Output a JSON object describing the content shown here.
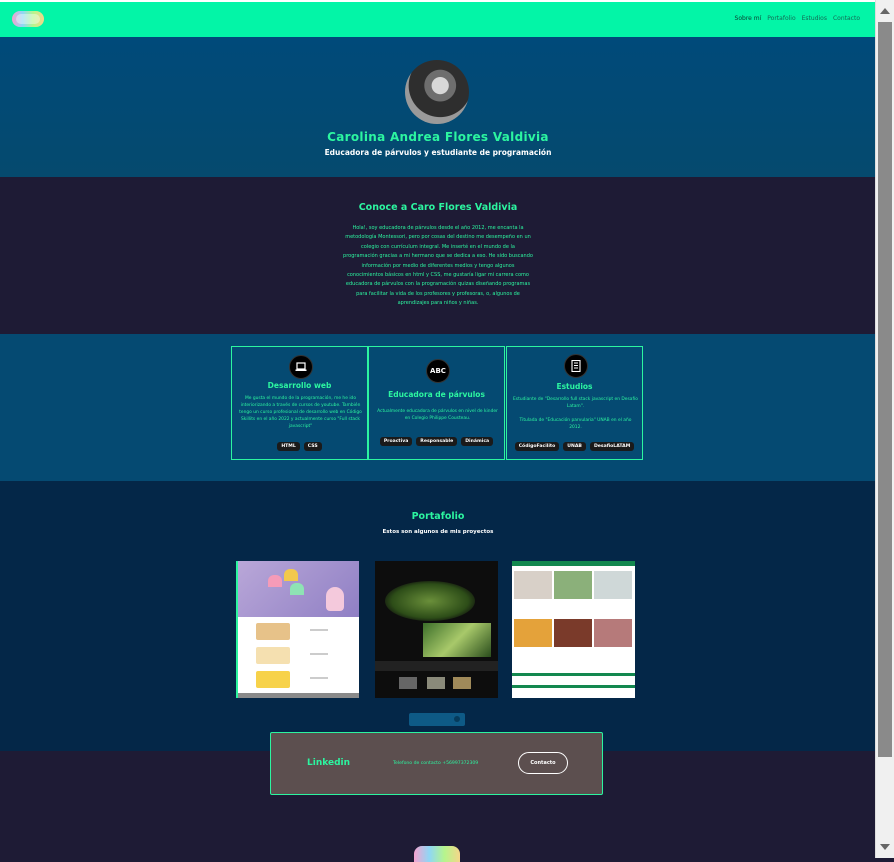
{
  "navbar": {
    "links": [
      "Sobre mí",
      "Portafolio",
      "Estudios",
      "Contacto"
    ]
  },
  "hero": {
    "name": "Carolina Andrea Flores Valdivia",
    "subtitle": "Educadora de párvulos y estudiante de programación"
  },
  "about": {
    "title": "Conoce a Caro Flores Valdivia",
    "text": "Hola!, soy educadora de párvulos desde el año 2012, me encanta la metodología Montessori, pero por cosas del destino me desempeño en un colegio con currículum integral. Me inserté en el mundo de la programación gracias a mi hermano que se dedica a eso. He sido buscando información por medio de diferentes medios y tengo algunos conocimientos básicos en html y CSS, me gustaría ligar mi carrera como educadora de párvulos con la programación quizas diseñando programas para facilitar la vida de los profesores y profesoras, o, algunos de aprendizajes para niños y niñas."
  },
  "skills": [
    {
      "icon": "laptop-icon",
      "title": "Desarrollo web",
      "text": "Me gusta el mundo de la programación, me he ido interiorizando a través de cursos de youtube. También tengo un curso profesional de desarrollo web en Código Skillits en el año 2022 y actualmente curso \"Full stack javascript\"",
      "badges": [
        "HTML",
        "CSS"
      ]
    },
    {
      "icon": "abc-icon",
      "icon_text": "ABC",
      "title": "Educadora de párvulos",
      "text": "Actualmente educadora de párvulos en nivel de kinder en Colegio Philippe Cousteau.",
      "badges": [
        "Proactiva",
        "Responsable",
        "Dinámica"
      ]
    },
    {
      "icon": "notebook-icon",
      "title": "Estudios",
      "text": "Estudiante de \"Desarrollo full stack javascript en Desafío Latam\".",
      "text2": "Titulada de \"Educación parvularia\" UNAB en el año 2012.",
      "badges": [
        "CódigoFacilito",
        "UNAB",
        "DesafioLATAM"
      ]
    }
  ],
  "portfolio": {
    "title": "Portafolio",
    "subtitle": "Estos son algunos de mis proyectos"
  },
  "contact": {
    "linkedin": "Linkedin",
    "phone": "Telefono de contacto  +56997372309",
    "button": "Contacto"
  }
}
